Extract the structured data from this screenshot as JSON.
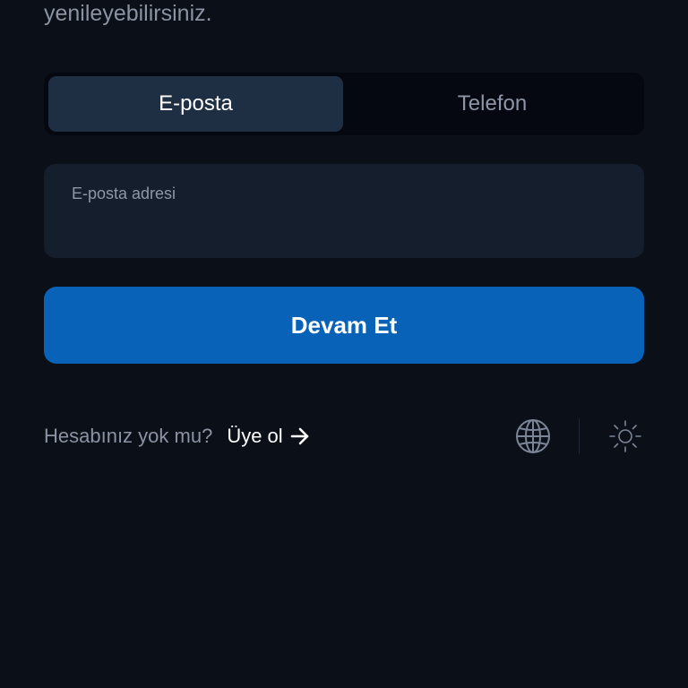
{
  "header": {
    "subtitle_tail": "yenileyebilirsiniz."
  },
  "tabs": [
    {
      "label": "E-posta",
      "active": true
    },
    {
      "label": "Telefon",
      "active": false
    }
  ],
  "email_field": {
    "label": "E-posta adresi",
    "value": "",
    "placeholder": ""
  },
  "actions": {
    "continue_label": "Devam Et"
  },
  "footer": {
    "question": "Hesabınız yok mu?",
    "signup_label": "Üye ol",
    "icons": [
      "globe-icon",
      "sun-icon"
    ]
  },
  "colors": {
    "background": "#0b0f18",
    "tab_active": "#1e2f44",
    "field_bg": "#151e2c",
    "primary_button": "#0862b7",
    "muted_text": "#8b93a3"
  }
}
